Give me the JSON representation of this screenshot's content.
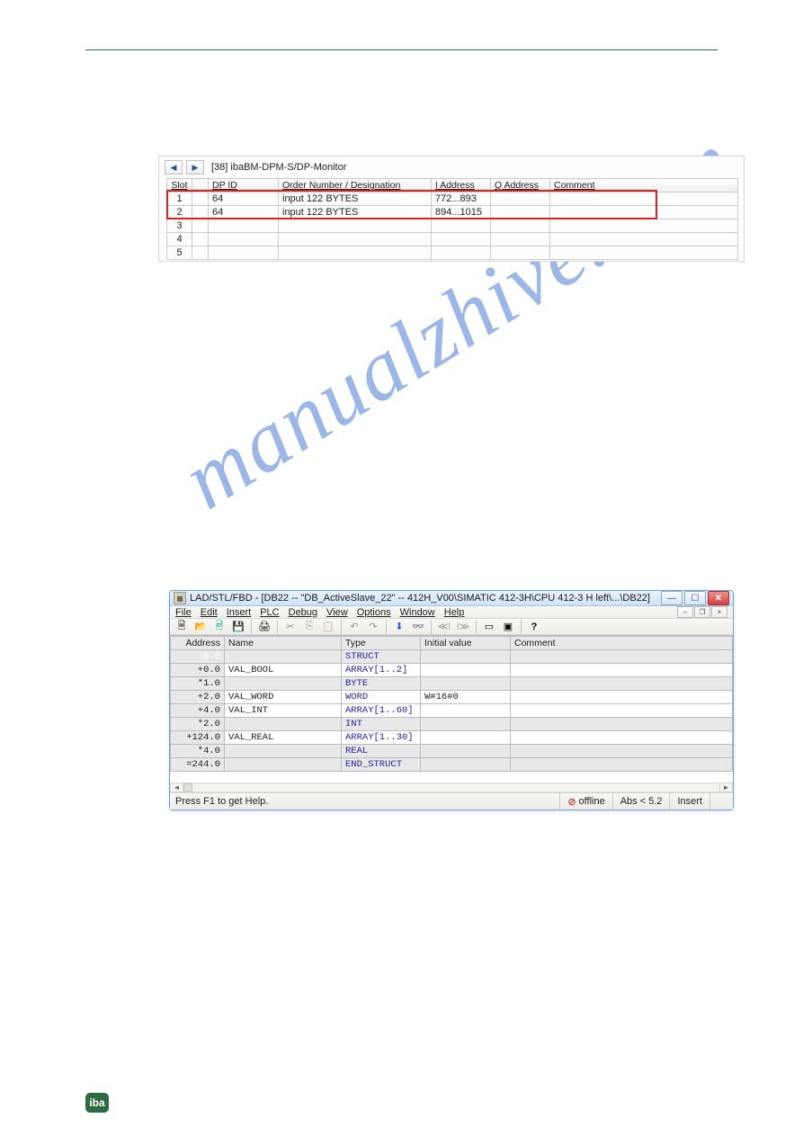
{
  "watermark": "manualzhive.com",
  "footer_logo": "iba",
  "panel1": {
    "title": "[38] ibaBM-DPM-S/DP-Monitor",
    "headers": [
      "Slot",
      "",
      "DP ID",
      "Order Number / Designation",
      "I Address",
      "Q Address",
      "Comment"
    ],
    "rows": [
      {
        "slot": "1",
        "dpid": "64",
        "order": "input 122 BYTES",
        "iaddr": "772...893",
        "qaddr": "",
        "comment": ""
      },
      {
        "slot": "2",
        "dpid": "64",
        "order": "input 122 BYTES",
        "iaddr": "894...1015",
        "qaddr": "",
        "comment": ""
      },
      {
        "slot": "3",
        "dpid": "",
        "order": "",
        "iaddr": "",
        "qaddr": "",
        "comment": ""
      },
      {
        "slot": "4",
        "dpid": "",
        "order": "",
        "iaddr": "",
        "qaddr": "",
        "comment": ""
      },
      {
        "slot": "5",
        "dpid": "",
        "order": "",
        "iaddr": "",
        "qaddr": "",
        "comment": ""
      }
    ]
  },
  "win2": {
    "title": "LAD/STL/FBD  - [DB22 -- \"DB_ActiveSlave_22\" -- 412H_V00\\SIMATIC 412-3H\\CPU 412-3 H left\\...\\DB22]",
    "menu": [
      "File",
      "Edit",
      "Insert",
      "PLC",
      "Debug",
      "View",
      "Options",
      "Window",
      "Help"
    ],
    "status_left": "Press F1 to get Help.",
    "status_offline": "offline",
    "status_abs": "Abs < 5.2",
    "status_insert": "Insert",
    "headers": [
      "Address",
      "Name",
      "Type",
      "Initial value",
      "Comment"
    ],
    "rows": [
      {
        "addr": "0.0",
        "name": "",
        "type": "STRUCT",
        "init": "",
        "grey": true,
        "sel": true
      },
      {
        "addr": "+0.0",
        "name": "VAL_BOOL",
        "type": "ARRAY[1..2]",
        "init": "",
        "grey": false
      },
      {
        "addr": "*1.0",
        "name": "",
        "type": "BYTE",
        "init": "",
        "grey": true
      },
      {
        "addr": "+2.0",
        "name": "VAL_WORD",
        "type": "WORD",
        "init": "W#16#0",
        "grey": false
      },
      {
        "addr": "+4.0",
        "name": "VAL_INT",
        "type": "ARRAY[1..60]",
        "init": "",
        "grey": false
      },
      {
        "addr": "*2.0",
        "name": "",
        "type": "INT",
        "init": "",
        "grey": true
      },
      {
        "addr": "+124.0",
        "name": "VAL_REAL",
        "type": "ARRAY[1..30]",
        "init": "",
        "grey": false
      },
      {
        "addr": "*4.0",
        "name": "",
        "type": "REAL",
        "init": "",
        "grey": true
      },
      {
        "addr": "=244.0",
        "name": "",
        "type": "END_STRUCT",
        "init": "",
        "grey": true
      }
    ]
  }
}
